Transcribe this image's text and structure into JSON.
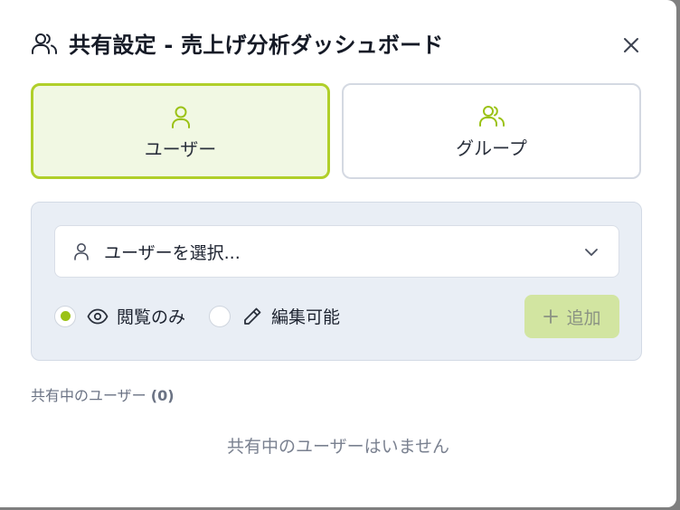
{
  "dialog": {
    "title": "共有設定 - 売上げ分析ダッシュボード",
    "header_icon": "users-icon",
    "close_icon": "close-icon"
  },
  "share_type": {
    "selected": "user",
    "options": [
      {
        "id": "user",
        "label": "ユーザー",
        "icon": "user-icon"
      },
      {
        "id": "group",
        "label": "グループ",
        "icon": "users-icon"
      }
    ]
  },
  "form": {
    "select_placeholder": "ユーザーを選択...",
    "select_icon": "user-icon",
    "permissions": [
      {
        "id": "view",
        "label": "閲覧のみ",
        "icon": "eye-icon",
        "checked": true
      },
      {
        "id": "edit",
        "label": "編集可能",
        "icon": "pencil-icon",
        "checked": false
      }
    ],
    "add_label": "追加",
    "add_icon": "plus-icon",
    "add_enabled": false
  },
  "shared": {
    "title": "共有中のユーザー",
    "count": "(0)",
    "empty_message": "共有中のユーザーはいません"
  },
  "colors": {
    "accent": "#9bc216",
    "accent_border": "#b0cf2a",
    "accent_bg": "#f1f8e3",
    "add_button_bg": "#d2e5a1",
    "panel_bg": "#e9eef5"
  }
}
